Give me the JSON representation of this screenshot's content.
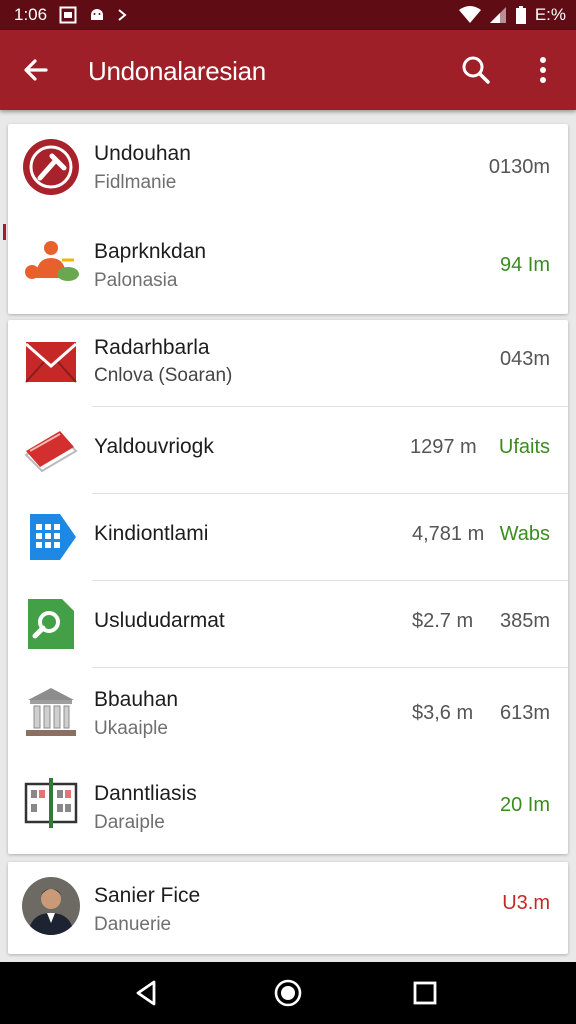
{
  "status_bar": {
    "time": "1:06",
    "battery_text": "E:%"
  },
  "app_bar": {
    "title": "Undonalaresian"
  },
  "colors": {
    "app_bar": "#9e1f27",
    "status_bar": "#5f0c14",
    "green_value": "#3b8c1f",
    "red_value": "#c62828"
  },
  "cards": [
    {
      "rows": [
        {
          "icon": "red-circle-logo-icon",
          "title": "Undouhan",
          "subtitle": "Fidlmanie",
          "value": "0130m",
          "value_color": "gray"
        },
        {
          "icon": "people-group-icon",
          "title": "Baprknkdan",
          "subtitle": "Palonasia",
          "value": "94 Im",
          "value_color": "green"
        }
      ]
    },
    {
      "rows": [
        {
          "icon": "mail-envelope-icon",
          "title": "Radarhbarla",
          "subtitle": "Cnlova (Soaran)",
          "value": "043m",
          "value_color": "gray"
        },
        {
          "icon": "red-book-icon",
          "title": "Yaldouvriogk",
          "subtitle": "",
          "value": "1297 m",
          "value_secondary": "Ufaits",
          "value_secondary_color": "green"
        },
        {
          "icon": "blue-calendar-icon",
          "title": "Kindiontlami",
          "subtitle": "",
          "value": "4,781 m",
          "value_secondary": "Wabs",
          "value_secondary_color": "green"
        },
        {
          "icon": "green-file-search-icon",
          "title": "Uslududarmat",
          "subtitle": "",
          "value": "$2.7 m",
          "value_secondary": "385m",
          "value_secondary_color": "gray"
        },
        {
          "icon": "bank-building-icon",
          "title": "Bbauhan",
          "subtitle": "Ukaaiple",
          "value": "$3,6 m",
          "value_secondary": "613m",
          "value_secondary_color": "gray"
        },
        {
          "icon": "film-board-icon",
          "title": "Danntliasis",
          "subtitle": "Daraiple",
          "value": "20 Im",
          "value_color": "green"
        }
      ]
    },
    {
      "rows": [
        {
          "icon": "person-avatar",
          "title": "Sanier Fice",
          "subtitle": "Danuerie",
          "value": "U3.m",
          "value_color": "red"
        }
      ]
    }
  ]
}
